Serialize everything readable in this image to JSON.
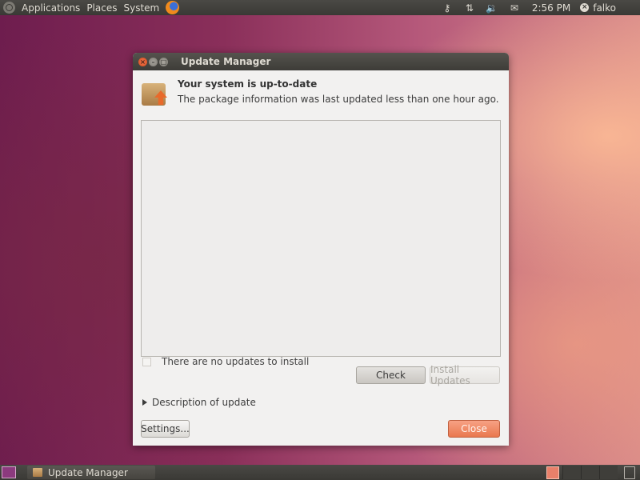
{
  "top_panel": {
    "menus": [
      "Applications",
      "Places",
      "System"
    ],
    "clock": "2:56 PM",
    "user": "falko",
    "tray_icons": [
      "key-icon",
      "network-arrows-icon",
      "volume-icon",
      "mail-icon"
    ]
  },
  "window": {
    "title": "Update Manager",
    "header_title": "Your system is up-to-date",
    "header_subtitle": "The package information was last updated less than one hour ago.",
    "no_updates_label": "There are no updates to install",
    "check_label": "Check",
    "install_label": "Install Updates",
    "description_label": "Description of update",
    "settings_label": "Settings...",
    "close_label": "Close"
  },
  "bottom_panel": {
    "task_label": "Update Manager"
  },
  "colors": {
    "accent": "#e9784f",
    "panel": "#3a3935"
  }
}
